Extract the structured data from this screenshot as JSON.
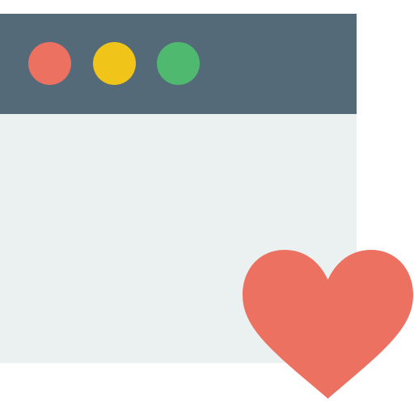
{
  "window": {
    "titlebar_color": "#546a79",
    "content_color": "#ebf0f1"
  },
  "window_controls": [
    {
      "name": "close-dot",
      "color": "#ed7161"
    },
    {
      "name": "minimize-dot",
      "color": "#f0c419"
    },
    {
      "name": "maximize-dot",
      "color": "#4fba6f"
    }
  ],
  "badge": {
    "icon": "heart-icon",
    "color": "#ed7161"
  }
}
